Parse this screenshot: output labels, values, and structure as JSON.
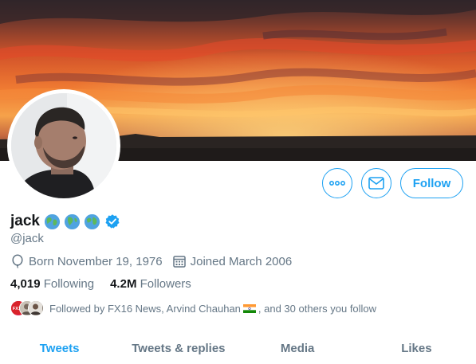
{
  "profile": {
    "display_name": "jack",
    "handle": "@jack",
    "born": "Born November 19, 1976",
    "joined": "Joined March 2006"
  },
  "counts": {
    "following_num": "4,019",
    "following_label": "Following",
    "followers_num": "4.2M",
    "followers_label": "Followers"
  },
  "followed_by": {
    "prefix": "Followed by FX16 News, Arvind Chauhan",
    "suffix": ", and 30 others you follow",
    "mini_avatar_text": "FX16"
  },
  "actions": {
    "follow_label": "Follow"
  },
  "tabs": [
    {
      "label": "Tweets",
      "active": true
    },
    {
      "label": "Tweets & replies",
      "active": false
    },
    {
      "label": "Media",
      "active": false
    },
    {
      "label": "Likes",
      "active": false
    }
  ],
  "icons": {
    "more": "more-icon",
    "mail": "mail-icon",
    "verified": "verified-badge-icon",
    "birthday": "balloon-icon",
    "calendar": "calendar-icon",
    "globe": "globe-emoji-icon",
    "flag": "india-flag-icon"
  },
  "colors": {
    "accent": "#1da1f2",
    "text_primary": "#14171a",
    "text_secondary": "#657786"
  }
}
